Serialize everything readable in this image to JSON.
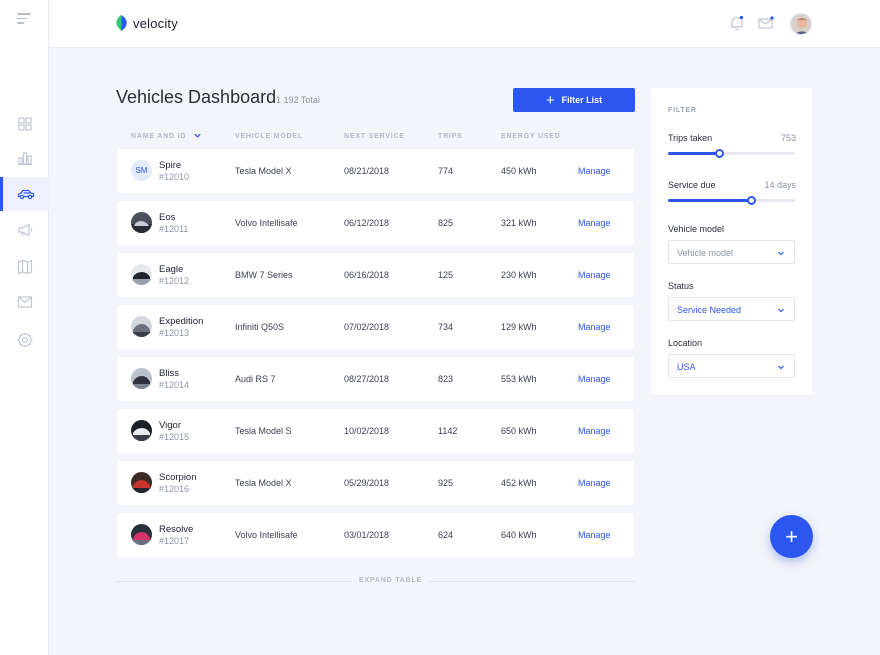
{
  "app": {
    "name": "velocity"
  },
  "header": {
    "title": "Vehicles Dashboard",
    "total": "1 192 Total",
    "filter_button": "Filter List"
  },
  "table": {
    "headers": {
      "name": "NAME AND ID",
      "model": "VEHICLE MODEL",
      "service": "NEXT SERVICE",
      "trips": "TRIPS",
      "energy": "ENERGY USED"
    },
    "action_label": "Manage",
    "rows": [
      {
        "name": "Spire",
        "id": "#12010",
        "model": "Tesla Model X",
        "service": "08/21/2018",
        "trips": "774",
        "energy": "450 kWh",
        "initials": "SM"
      },
      {
        "name": "Eos",
        "id": "#12011",
        "model": "Volvo Intellisafe",
        "service": "06/12/2018",
        "trips": "825",
        "energy": "321 kWh"
      },
      {
        "name": "Eagle",
        "id": "#12012",
        "model": "BMW 7 Series",
        "service": "06/16/2018",
        "trips": "125",
        "energy": "230 kWh"
      },
      {
        "name": "Expedition",
        "id": "#12013",
        "model": "Infiniti Q50S",
        "service": "07/02/2018",
        "trips": "734",
        "energy": "129 kWh"
      },
      {
        "name": "Bliss",
        "id": "#12014",
        "model": "Audi RS 7",
        "service": "08/27/2018",
        "trips": "823",
        "energy": "553 kWh"
      },
      {
        "name": "Vigor",
        "id": "#12015",
        "model": "Tesla Model S",
        "service": "10/02/2018",
        "trips": "1142",
        "energy": "650 kWh"
      },
      {
        "name": "Scorpion",
        "id": "#12016",
        "model": "Tesla Model X",
        "service": "05/29/2018",
        "trips": "925",
        "energy": "452 kWh"
      },
      {
        "name": "Resolve",
        "id": "#12017",
        "model": "Volvo Intellisafe",
        "service": "03/01/2018",
        "trips": "624",
        "energy": "640 kWh"
      }
    ],
    "expand_label": "EXPAND TABLE"
  },
  "filter": {
    "title": "FILTER",
    "trips": {
      "label": "Trips taken",
      "value": "753",
      "level": 0.4
    },
    "service": {
      "label": "Service due",
      "value": "14 days",
      "level": 0.65
    },
    "vehicle_model": {
      "label": "Vehicle model",
      "placeholder": "Vehicle model"
    },
    "status": {
      "label": "Status",
      "value": "Service Needed"
    },
    "location": {
      "label": "Location",
      "value": "USA"
    }
  },
  "colors": {
    "accent": "#2b57f0",
    "background": "#f4f5fa"
  },
  "icons": {
    "sidebar": [
      "menu-icon",
      "dashboard-icon",
      "bar-chart-icon",
      "car-icon",
      "megaphone-icon",
      "map-icon",
      "mail-icon",
      "settings-icon"
    ],
    "topbar": [
      "bell-icon",
      "mail-icon",
      "avatar"
    ]
  },
  "fab": {
    "icon": "plus-icon"
  }
}
